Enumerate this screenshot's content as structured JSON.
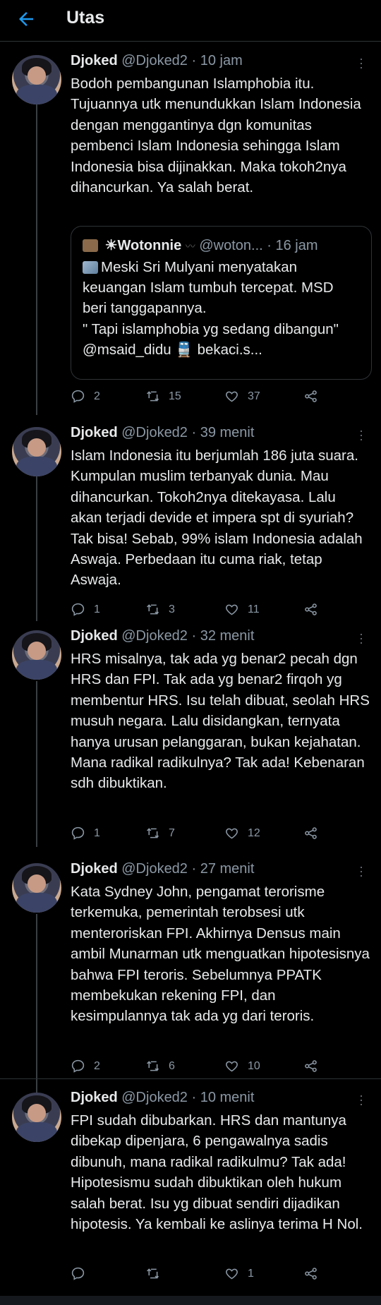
{
  "header": {
    "title": "Utas",
    "back_icon": "arrow-left-icon",
    "accent": "#1d9bf0"
  },
  "tweets": [
    {
      "name": "Djoked",
      "handle": "@Djoked2",
      "time": "· 10 jam",
      "text": "Bodoh pembangunan Islamphobia itu. Tujuannya utk menundukkan Islam Indonesia dengan menggantinya dgn komunitas pembenci Islam Indonesia sehingga Islam Indonesia bisa dijinakkan. Maka tokoh2nya dihancurkan. Ya salah berat.",
      "quote": {
        "name": "☀Wotonnie",
        "handle": "@woton...",
        "time": "· 16 jam",
        "text": "Meski Sri Mulyani menyatakan keuangan Islam tumbuh tercepat. MSD beri tanggapannya.\n\" Tapi islamphobia yg sedang dibangun\" @msaid_didu 🚆 bekaci.s..."
      },
      "replies": "2",
      "retweets": "15",
      "likes": "37"
    },
    {
      "name": "Djoked",
      "handle": "@Djoked2",
      "time": "· 39 menit",
      "text": "Islam Indonesia itu berjumlah 186 juta suara. Kumpulan muslim terbanyak dunia. Mau dihancurkan. Tokoh2nya ditekayasa. Lalu akan terjadi devide et impera spt di syuriah? Tak bisa! Sebab, 99% islam Indonesia adalah Aswaja. Perbedaan itu cuma riak, tetap Aswaja.",
      "replies": "1",
      "retweets": "3",
      "likes": "11"
    },
    {
      "name": "Djoked",
      "handle": "@Djoked2",
      "time": "· 32 menit",
      "text": "HRS misalnya, tak ada yg benar2 pecah dgn HRS dan FPI. Tak ada yg benar2 firqoh yg membentur HRS. Isu telah dibuat, seolah HRS musuh negara. Lalu disidangkan, ternyata hanya urusan pelanggaran, bukan kejahatan. Mana radikal radikulnya? Tak ada! Kebenaran sdh dibuktikan.",
      "replies": "1",
      "retweets": "7",
      "likes": "12"
    },
    {
      "name": "Djoked",
      "handle": "@Djoked2",
      "time": "· 27 menit",
      "text": "Kata Sydney John, pengamat terorisme terkemuka, pemerintah terobsesi utk menteroriskan FPI. Akhirnya Densus main ambil Munarman utk menguatkan hipotesisnya bahwa FPI teroris. Sebelumnya PPATK membekukan rekening FPI, dan kesimpulannya tak ada yg dari teroris.",
      "replies": "2",
      "retweets": "6",
      "likes": "10"
    },
    {
      "name": "Djoked",
      "handle": "@Djoked2",
      "time": "· 10 menit",
      "text": "FPI sudah dibubarkan. HRS dan mantunya dibekap dipenjara, 6 pengawalnya sadis dibunuh, mana radikal radikulmu? Tak ada! Hipotesismu sudah dibuktikan oleh hukum salah berat. Isu yg dibuat sendiri dijadikan hipotesis. Ya kembali ke aslinya terima H Nol.",
      "replies": "",
      "retweets": "",
      "likes": "1"
    }
  ]
}
